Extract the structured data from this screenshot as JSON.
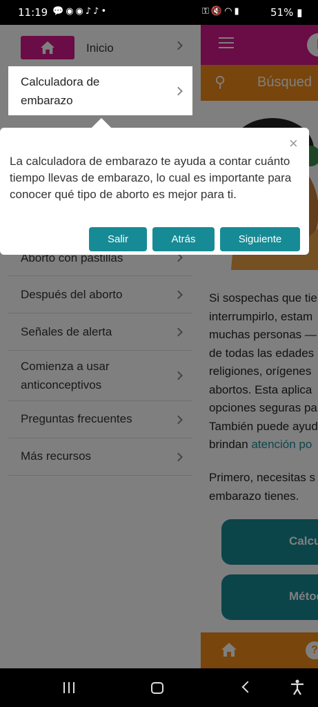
{
  "status_bar": {
    "time": "11:19",
    "notification_icons": [
      "chat-bubble-icon",
      "messenger-icon",
      "messenger-icon",
      "tiktok-icon",
      "tiktok-icon",
      "dot-icon"
    ],
    "system_icons": [
      "key-icon",
      "mute-icon",
      "wifi-icon",
      "volte-icon",
      "signal-icon"
    ],
    "battery": "51%"
  },
  "drawer": {
    "home_label": "Inicio",
    "highlighted_item": "Calculadora de embarazo",
    "items": [
      {
        "label": "Aborto con pastillas"
      },
      {
        "label": "Después del aborto"
      },
      {
        "label": "Señales de alerta"
      },
      {
        "label": "Comienza a usar anticonceptivos"
      },
      {
        "label": "Preguntas frecuentes"
      },
      {
        "label": "Más recursos"
      }
    ]
  },
  "tooltip": {
    "text": "La calculadora de embarazo te ayuda a contar cuánto tiempo llevas de embarazo, lo cual es importante para conocer qué tipo de aborto es mejor para ti.",
    "close_symbol": "×",
    "buttons": {
      "exit": "Salir",
      "back": "Atrás",
      "next": "Siguiente"
    }
  },
  "background": {
    "search_placeholder": "Búsqued",
    "logo_letter": "I",
    "paragraph_lines": [
      "Si sospechas que tie",
      "interrumpirlo, estam",
      "muchas personas —",
      "de todas las edades",
      "religiones, orígenes",
      "abortos. Esta aplica",
      "opciones seguras pa",
      "También puede ayud"
    ],
    "paragraph_last_prefix": "brindan ",
    "paragraph_link": "atención po",
    "paragraph2_lines": [
      "Primero, necesitas s",
      "embarazo tienes."
    ],
    "button1": "Calcu",
    "button2": "Métod",
    "help_symbol": "?"
  },
  "colors": {
    "magenta": "#d4198a",
    "orange": "#f08a19",
    "teal": "#178b95"
  }
}
